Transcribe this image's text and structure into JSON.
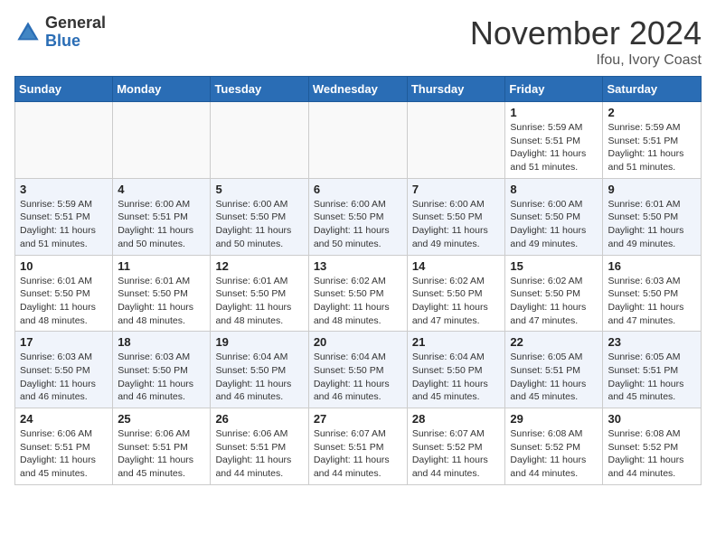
{
  "header": {
    "logo_general": "General",
    "logo_blue": "Blue",
    "month_title": "November 2024",
    "location": "Ifou, Ivory Coast"
  },
  "weekdays": [
    "Sunday",
    "Monday",
    "Tuesday",
    "Wednesday",
    "Thursday",
    "Friday",
    "Saturday"
  ],
  "weeks": [
    [
      {
        "day": "",
        "info": ""
      },
      {
        "day": "",
        "info": ""
      },
      {
        "day": "",
        "info": ""
      },
      {
        "day": "",
        "info": ""
      },
      {
        "day": "",
        "info": ""
      },
      {
        "day": "1",
        "info": "Sunrise: 5:59 AM\nSunset: 5:51 PM\nDaylight: 11 hours\nand 51 minutes."
      },
      {
        "day": "2",
        "info": "Sunrise: 5:59 AM\nSunset: 5:51 PM\nDaylight: 11 hours\nand 51 minutes."
      }
    ],
    [
      {
        "day": "3",
        "info": "Sunrise: 5:59 AM\nSunset: 5:51 PM\nDaylight: 11 hours\nand 51 minutes."
      },
      {
        "day": "4",
        "info": "Sunrise: 6:00 AM\nSunset: 5:51 PM\nDaylight: 11 hours\nand 50 minutes."
      },
      {
        "day": "5",
        "info": "Sunrise: 6:00 AM\nSunset: 5:50 PM\nDaylight: 11 hours\nand 50 minutes."
      },
      {
        "day": "6",
        "info": "Sunrise: 6:00 AM\nSunset: 5:50 PM\nDaylight: 11 hours\nand 50 minutes."
      },
      {
        "day": "7",
        "info": "Sunrise: 6:00 AM\nSunset: 5:50 PM\nDaylight: 11 hours\nand 49 minutes."
      },
      {
        "day": "8",
        "info": "Sunrise: 6:00 AM\nSunset: 5:50 PM\nDaylight: 11 hours\nand 49 minutes."
      },
      {
        "day": "9",
        "info": "Sunrise: 6:01 AM\nSunset: 5:50 PM\nDaylight: 11 hours\nand 49 minutes."
      }
    ],
    [
      {
        "day": "10",
        "info": "Sunrise: 6:01 AM\nSunset: 5:50 PM\nDaylight: 11 hours\nand 48 minutes."
      },
      {
        "day": "11",
        "info": "Sunrise: 6:01 AM\nSunset: 5:50 PM\nDaylight: 11 hours\nand 48 minutes."
      },
      {
        "day": "12",
        "info": "Sunrise: 6:01 AM\nSunset: 5:50 PM\nDaylight: 11 hours\nand 48 minutes."
      },
      {
        "day": "13",
        "info": "Sunrise: 6:02 AM\nSunset: 5:50 PM\nDaylight: 11 hours\nand 48 minutes."
      },
      {
        "day": "14",
        "info": "Sunrise: 6:02 AM\nSunset: 5:50 PM\nDaylight: 11 hours\nand 47 minutes."
      },
      {
        "day": "15",
        "info": "Sunrise: 6:02 AM\nSunset: 5:50 PM\nDaylight: 11 hours\nand 47 minutes."
      },
      {
        "day": "16",
        "info": "Sunrise: 6:03 AM\nSunset: 5:50 PM\nDaylight: 11 hours\nand 47 minutes."
      }
    ],
    [
      {
        "day": "17",
        "info": "Sunrise: 6:03 AM\nSunset: 5:50 PM\nDaylight: 11 hours\nand 46 minutes."
      },
      {
        "day": "18",
        "info": "Sunrise: 6:03 AM\nSunset: 5:50 PM\nDaylight: 11 hours\nand 46 minutes."
      },
      {
        "day": "19",
        "info": "Sunrise: 6:04 AM\nSunset: 5:50 PM\nDaylight: 11 hours\nand 46 minutes."
      },
      {
        "day": "20",
        "info": "Sunrise: 6:04 AM\nSunset: 5:50 PM\nDaylight: 11 hours\nand 46 minutes."
      },
      {
        "day": "21",
        "info": "Sunrise: 6:04 AM\nSunset: 5:50 PM\nDaylight: 11 hours\nand 45 minutes."
      },
      {
        "day": "22",
        "info": "Sunrise: 6:05 AM\nSunset: 5:51 PM\nDaylight: 11 hours\nand 45 minutes."
      },
      {
        "day": "23",
        "info": "Sunrise: 6:05 AM\nSunset: 5:51 PM\nDaylight: 11 hours\nand 45 minutes."
      }
    ],
    [
      {
        "day": "24",
        "info": "Sunrise: 6:06 AM\nSunset: 5:51 PM\nDaylight: 11 hours\nand 45 minutes."
      },
      {
        "day": "25",
        "info": "Sunrise: 6:06 AM\nSunset: 5:51 PM\nDaylight: 11 hours\nand 45 minutes."
      },
      {
        "day": "26",
        "info": "Sunrise: 6:06 AM\nSunset: 5:51 PM\nDaylight: 11 hours\nand 44 minutes."
      },
      {
        "day": "27",
        "info": "Sunrise: 6:07 AM\nSunset: 5:51 PM\nDaylight: 11 hours\nand 44 minutes."
      },
      {
        "day": "28",
        "info": "Sunrise: 6:07 AM\nSunset: 5:52 PM\nDaylight: 11 hours\nand 44 minutes."
      },
      {
        "day": "29",
        "info": "Sunrise: 6:08 AM\nSunset: 5:52 PM\nDaylight: 11 hours\nand 44 minutes."
      },
      {
        "day": "30",
        "info": "Sunrise: 6:08 AM\nSunset: 5:52 PM\nDaylight: 11 hours\nand 44 minutes."
      }
    ]
  ]
}
